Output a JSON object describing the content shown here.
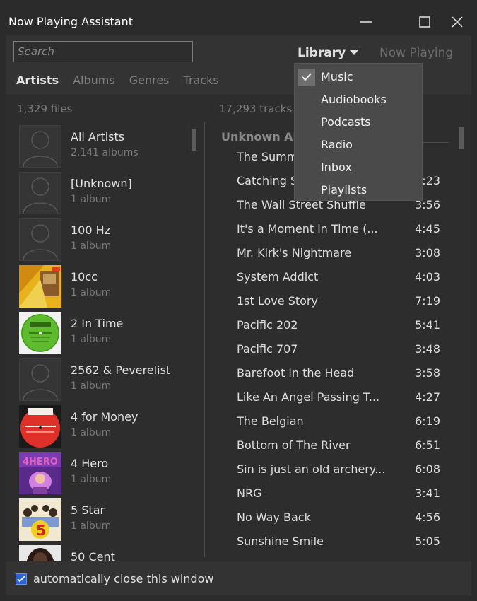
{
  "window": {
    "title": "Now Playing Assistant"
  },
  "search": {
    "placeholder": "Search",
    "value": ""
  },
  "tabs": [
    {
      "label": "Artists",
      "active": true
    },
    {
      "label": "Albums",
      "active": false
    },
    {
      "label": "Genres",
      "active": false
    },
    {
      "label": "Tracks",
      "active": false
    }
  ],
  "source_selector": {
    "label": "Library",
    "icon": "chevron-down-icon"
  },
  "now_playing_tab": {
    "label": "Now Playing"
  },
  "counts": {
    "files": "1,329 files",
    "tracks": "17,293 tracks"
  },
  "artists": [
    {
      "name": "All Artists",
      "sub": "2,141 albums",
      "art": "placeholder"
    },
    {
      "name": "[Unknown]",
      "sub": "1 album",
      "art": "placeholder"
    },
    {
      "name": "100 Hz",
      "sub": "1 album",
      "art": "placeholder"
    },
    {
      "name": "10cc",
      "sub": "1 album",
      "art": "cover"
    },
    {
      "name": "2 In Time",
      "sub": "1 album",
      "art": "cover"
    },
    {
      "name": "2562 & Peverelist",
      "sub": "1 album",
      "art": "placeholder"
    },
    {
      "name": "4 for Money",
      "sub": "1 album",
      "art": "cover"
    },
    {
      "name": "4 Hero",
      "sub": "1 album",
      "art": "cover"
    },
    {
      "name": "5 Star",
      "sub": "1 album",
      "art": "cover"
    },
    {
      "name": "50 Cent",
      "sub": "",
      "art": "cover"
    }
  ],
  "album_header": "Unknown Al",
  "tracks": [
    {
      "title": "The Summ",
      "duration": ""
    },
    {
      "title": "Catching S",
      "duration": ":23"
    },
    {
      "title": "The Wall Street Shuffle",
      "duration": "3:56"
    },
    {
      "title": "It's a Moment in Time (...",
      "duration": "4:45"
    },
    {
      "title": "Mr. Kirk's Nightmare",
      "duration": "3:08"
    },
    {
      "title": "System Addict",
      "duration": "4:03"
    },
    {
      "title": "1st Love Story",
      "duration": "7:19"
    },
    {
      "title": "Pacific 202",
      "duration": "5:41"
    },
    {
      "title": "Pacific 707",
      "duration": "3:48"
    },
    {
      "title": "Barefoot in the Head",
      "duration": "3:58"
    },
    {
      "title": "Like An Angel Passing T...",
      "duration": "4:27"
    },
    {
      "title": "The Belgian",
      "duration": "6:19"
    },
    {
      "title": "Bottom of The River",
      "duration": "6:51"
    },
    {
      "title": "Sin is just an old archery...",
      "duration": "6:08"
    },
    {
      "title": "NRG",
      "duration": "3:41"
    },
    {
      "title": "No Way Back",
      "duration": "4:56"
    },
    {
      "title": "Sunshine Smile",
      "duration": "5:05"
    }
  ],
  "library_menu": [
    {
      "label": "Music",
      "checked": true
    },
    {
      "label": "Audiobooks",
      "checked": false
    },
    {
      "label": "Podcasts",
      "checked": false
    },
    {
      "label": "Radio",
      "checked": false
    },
    {
      "label": "Inbox",
      "checked": false
    },
    {
      "label": "Playlists",
      "checked": false
    }
  ],
  "footer": {
    "auto_close_label": "automatically close this window",
    "auto_close_checked": true
  },
  "colors": {
    "accent": "#2c63d6",
    "background": "#2b2b2b",
    "panel": "#333333"
  }
}
